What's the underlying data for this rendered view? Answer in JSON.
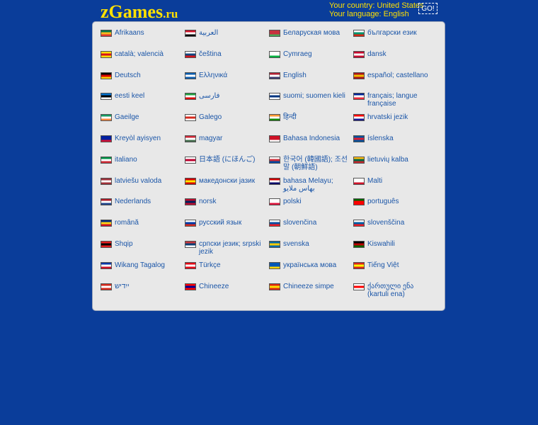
{
  "header": {
    "logo_main": "zGames",
    "logo_domain": ".ru",
    "country_line": "Your country: United States",
    "language_line": "Your language: English",
    "go_label": "GO!"
  },
  "languages": [
    {
      "label": "Afrikaans",
      "flag": [
        "#007749",
        "#ffb81c",
        "#de3831"
      ]
    },
    {
      "label": "العربية",
      "flag": [
        "#ce1126",
        "#ffffff",
        "#000000"
      ]
    },
    {
      "label": "Беларуская мова",
      "flag": [
        "#c8313e",
        "#c8313e",
        "#4aa657"
      ]
    },
    {
      "label": "български език",
      "flag": [
        "#ffffff",
        "#00966e",
        "#d62612"
      ]
    },
    {
      "label": "català; valencià",
      "flag": [
        "#fcdd09",
        "#da121a",
        "#fcdd09"
      ]
    },
    {
      "label": "čeština",
      "flag": [
        "#ffffff",
        "#11457e",
        "#d7141a"
      ]
    },
    {
      "label": "Cymraeg",
      "flag": [
        "#ffffff",
        "#ffffff",
        "#00b140"
      ]
    },
    {
      "label": "dansk",
      "flag": [
        "#c60c30",
        "#ffffff",
        "#c60c30"
      ]
    },
    {
      "label": "Deutsch",
      "flag": [
        "#000000",
        "#dd0000",
        "#ffce00"
      ]
    },
    {
      "label": "Ελληνικά",
      "flag": [
        "#0d5eaf",
        "#ffffff",
        "#0d5eaf"
      ]
    },
    {
      "label": "English",
      "flag": [
        "#b22234",
        "#ffffff",
        "#3c3b6e"
      ]
    },
    {
      "label": "español; castellano",
      "flag": [
        "#aa151b",
        "#f1bf00",
        "#aa151b"
      ]
    },
    {
      "label": "eesti keel",
      "flag": [
        "#0072ce",
        "#000000",
        "#ffffff"
      ]
    },
    {
      "label": "فارسی",
      "flag": [
        "#239f40",
        "#ffffff",
        "#da0000"
      ]
    },
    {
      "label": "suomi; suomen kieli",
      "flag": [
        "#ffffff",
        "#003580",
        "#ffffff"
      ]
    },
    {
      "label": "français; langue française",
      "flag": [
        "#002395",
        "#ffffff",
        "#ed2939"
      ]
    },
    {
      "label": "Gaeilge",
      "flag": [
        "#169b62",
        "#ffffff",
        "#ff883e"
      ]
    },
    {
      "label": "Galego",
      "flag": [
        "#ffffff",
        "#d52b1e",
        "#ffffff"
      ]
    },
    {
      "label": "हिन्दी",
      "flag": [
        "#ff9933",
        "#ffffff",
        "#138808"
      ]
    },
    {
      "label": "hrvatski jezik",
      "flag": [
        "#ff0000",
        "#ffffff",
        "#171796"
      ]
    },
    {
      "label": "Kreyòl ayisyen",
      "flag": [
        "#00209f",
        "#00209f",
        "#d21034"
      ]
    },
    {
      "label": "magyar",
      "flag": [
        "#ce2939",
        "#ffffff",
        "#477050"
      ]
    },
    {
      "label": "Bahasa Indonesia",
      "flag": [
        "#ce1126",
        "#ce1126",
        "#ffffff"
      ]
    },
    {
      "label": "íslenska",
      "flag": [
        "#02529c",
        "#dc1e35",
        "#02529c"
      ]
    },
    {
      "label": "italiano",
      "flag": [
        "#009246",
        "#ffffff",
        "#ce2b37"
      ]
    },
    {
      "label": "日本語 (にほんご)",
      "flag": [
        "#ffffff",
        "#bc002d",
        "#ffffff"
      ]
    },
    {
      "label": "한국어 (韓國語); 조선말 (朝鮮語)",
      "flag": [
        "#ffffff",
        "#cd2e3a",
        "#0047a0"
      ]
    },
    {
      "label": "lietuvių kalba",
      "flag": [
        "#fdb913",
        "#006a44",
        "#c1272d"
      ]
    },
    {
      "label": "latviešu valoda",
      "flag": [
        "#9e3039",
        "#ffffff",
        "#9e3039"
      ]
    },
    {
      "label": "македонски јазик",
      "flag": [
        "#d20000",
        "#ffe600",
        "#d20000"
      ]
    },
    {
      "label": "bahasa Melayu; بهاس ملايو",
      "flag": [
        "#cc0001",
        "#ffffff",
        "#010066"
      ]
    },
    {
      "label": "Malti",
      "flag": [
        "#ffffff",
        "#ffffff",
        "#cf142b"
      ]
    },
    {
      "label": "Nederlands",
      "flag": [
        "#ae1c28",
        "#ffffff",
        "#21468b"
      ]
    },
    {
      "label": "norsk",
      "flag": [
        "#ba0c2f",
        "#00205b",
        "#ba0c2f"
      ]
    },
    {
      "label": "polski",
      "flag": [
        "#ffffff",
        "#ffffff",
        "#dc143c"
      ]
    },
    {
      "label": "português",
      "flag": [
        "#006600",
        "#ff0000",
        "#ff0000"
      ]
    },
    {
      "label": "română",
      "flag": [
        "#002b7f",
        "#fcd116",
        "#ce1126"
      ]
    },
    {
      "label": "русский язык",
      "flag": [
        "#ffffff",
        "#0039a6",
        "#d52b1e"
      ]
    },
    {
      "label": "slovenčina",
      "flag": [
        "#ffffff",
        "#0b4ea2",
        "#ee1c25"
      ]
    },
    {
      "label": "slovenščina",
      "flag": [
        "#ffffff",
        "#005da4",
        "#ed1c24"
      ]
    },
    {
      "label": "Shqip",
      "flag": [
        "#e41e20",
        "#000000",
        "#e41e20"
      ]
    },
    {
      "label": "српски језик; srpski jezik",
      "flag": [
        "#c6363c",
        "#0c4076",
        "#ffffff"
      ]
    },
    {
      "label": "svenska",
      "flag": [
        "#006aa7",
        "#fecc00",
        "#006aa7"
      ]
    },
    {
      "label": "Kiswahili",
      "flag": [
        "#000000",
        "#bb0000",
        "#006600"
      ]
    },
    {
      "label": "Wikang Tagalog",
      "flag": [
        "#0038a8",
        "#ffffff",
        "#ce1126"
      ]
    },
    {
      "label": "Türkçe",
      "flag": [
        "#e30a17",
        "#ffffff",
        "#e30a17"
      ]
    },
    {
      "label": "українська мова",
      "flag": [
        "#0057b7",
        "#0057b7",
        "#ffd700"
      ]
    },
    {
      "label": "Tiếng Việt",
      "flag": [
        "#da251d",
        "#ffff00",
        "#da251d"
      ]
    },
    {
      "label": "ייִדיש",
      "flag": [
        "#d52b1e",
        "#ffffff",
        "#d52b1e"
      ]
    },
    {
      "label": "Chineeze",
      "flag": [
        "#fe0000",
        "#000095",
        "#fe0000"
      ]
    },
    {
      "label": "Chineeze simpe",
      "flag": [
        "#de2910",
        "#ffde00",
        "#de2910"
      ]
    },
    {
      "label": "ქართული ენა (kartuli ena)",
      "flag": [
        "#ffffff",
        "#ff0000",
        "#ffffff"
      ]
    }
  ]
}
